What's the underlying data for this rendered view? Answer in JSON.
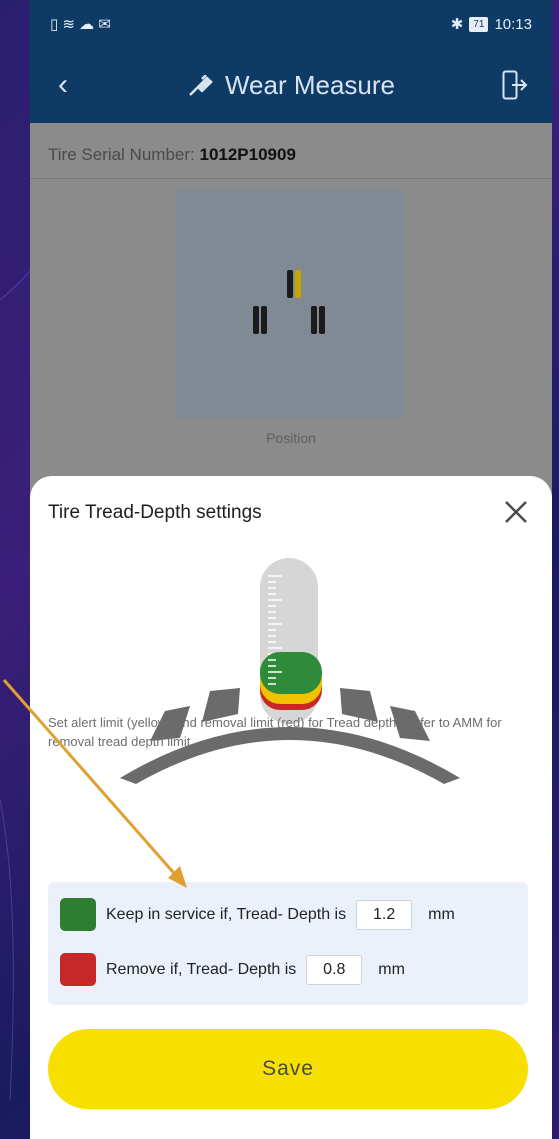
{
  "statusbar": {
    "time": "10:13",
    "battery": "71",
    "left_icons": "▯ ≋ ☁ ✉",
    "bt_icon": "✱"
  },
  "appbar": {
    "back_icon": "‹",
    "title": "Wear Measure"
  },
  "serial": {
    "label": "Tire Serial Number:",
    "value": "1012P10909"
  },
  "position": {
    "label": "Position"
  },
  "sheet": {
    "title": "Tire Tread-Depth settings",
    "description": "Set alert limit (yellow) and removal limit (red) for Tread depth. Refer to AMM for removal tread depth limit",
    "keep": {
      "label": "Keep in service if, Tread- Depth is",
      "value": "1.2",
      "unit": "mm",
      "color": "#2e7d32"
    },
    "remove": {
      "label": "Remove if, Tread- Depth is",
      "value": "0.8",
      "unit": "mm",
      "color": "#c62828"
    },
    "save_label": "Save"
  },
  "colors": {
    "appbar": "#0d3b66",
    "save": "#f7df00",
    "annotation_arrow": "#e0a030"
  }
}
